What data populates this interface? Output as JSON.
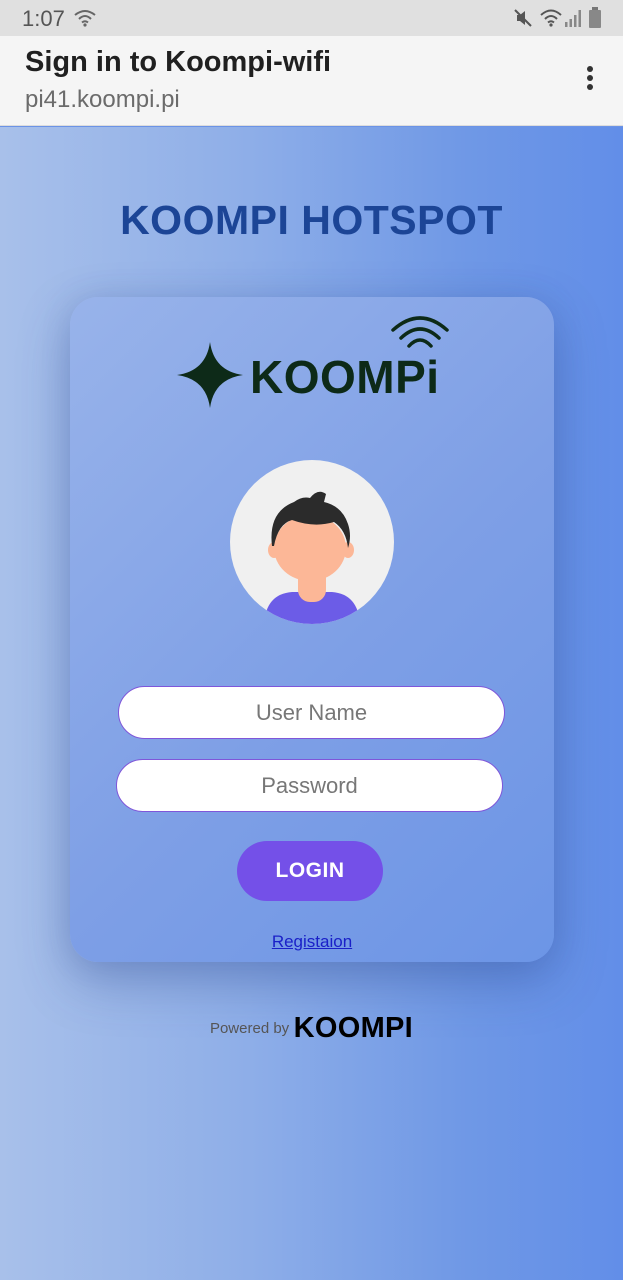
{
  "status_bar": {
    "time": "1:07",
    "icons": [
      "wifi-icon",
      "mute-icon",
      "wifi-icon",
      "signal-icon",
      "battery-icon"
    ]
  },
  "browser": {
    "title": "Sign in to Koompi-wifi",
    "url": "pi41.koompi.pi",
    "menu_icon": "more-vert-icon"
  },
  "page": {
    "heading": "KOOMPI HOTSPOT",
    "logo_text": "KOOMPi",
    "avatar_icon": "user-avatar-icon",
    "username_placeholder": "User Name",
    "password_placeholder": "Password",
    "login_label": "LOGIN",
    "registration_link": "Registaion",
    "powered_by": "Powered by",
    "powered_brand": "KOOMPI"
  },
  "colors": {
    "heading": "#1c4596",
    "accent": "#7450e8",
    "link": "#1a20c8",
    "logo": "#0d2a18"
  }
}
